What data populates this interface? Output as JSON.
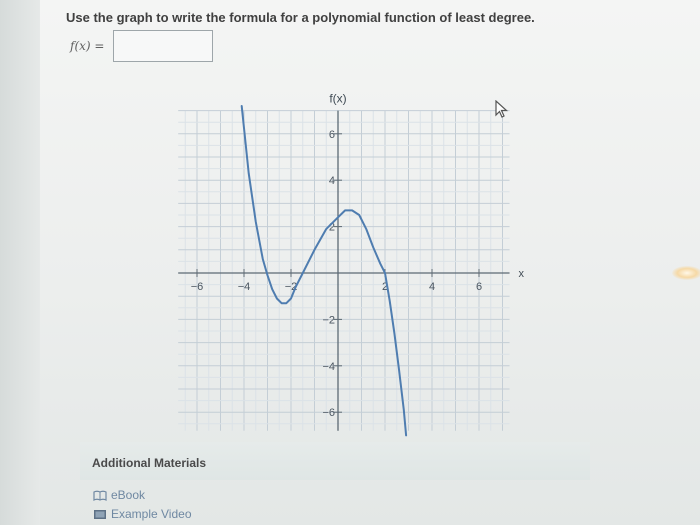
{
  "question": {
    "prompt": "Use the graph to write the formula for a polynomial function of least degree.",
    "answer_label": "f(x) =",
    "answer_value": ""
  },
  "chart_data": {
    "type": "line",
    "ylabel": "f(x)",
    "xlabel": "x",
    "xlim": [
      -7,
      8
    ],
    "ylim": [
      -7,
      7
    ],
    "grid": true,
    "x_ticks": [
      -6,
      -4,
      -2,
      2,
      4,
      6
    ],
    "y_ticks": [
      -6,
      -4,
      -2,
      2,
      4,
      6
    ],
    "x_tick_labels": [
      "−6",
      "−4",
      "−2",
      "2",
      "4",
      "6"
    ],
    "y_tick_labels": [
      "−6",
      "−4",
      "−2",
      "2",
      "4",
      "6"
    ],
    "series": [
      {
        "x": [
          -4.1,
          -3.8,
          -3.5,
          -3.2,
          -3.0,
          -2.8,
          -2.6,
          -2.4,
          -2.2,
          -2.0,
          -1.8,
          -1.5,
          -1.0,
          -0.5,
          0.0,
          0.3,
          0.6,
          0.9,
          1.2,
          1.5,
          1.8,
          2.0,
          2.2,
          2.4,
          2.6,
          2.8,
          2.9
        ],
        "y": [
          7.2,
          4.3,
          2.2,
          0.6,
          -0.1,
          -0.7,
          -1.1,
          -1.3,
          -1.3,
          -1.1,
          -0.6,
          0.0,
          1.0,
          1.9,
          2.4,
          2.7,
          2.7,
          2.5,
          1.9,
          1.1,
          0.4,
          0.0,
          -1.2,
          -2.6,
          -4.2,
          -5.9,
          -7.0
        ]
      }
    ]
  },
  "additional_materials": {
    "title": "Additional Materials",
    "links": [
      {
        "label": "eBook",
        "icon": "book-icon"
      },
      {
        "label": "Example Video",
        "icon": "video-icon"
      }
    ]
  }
}
